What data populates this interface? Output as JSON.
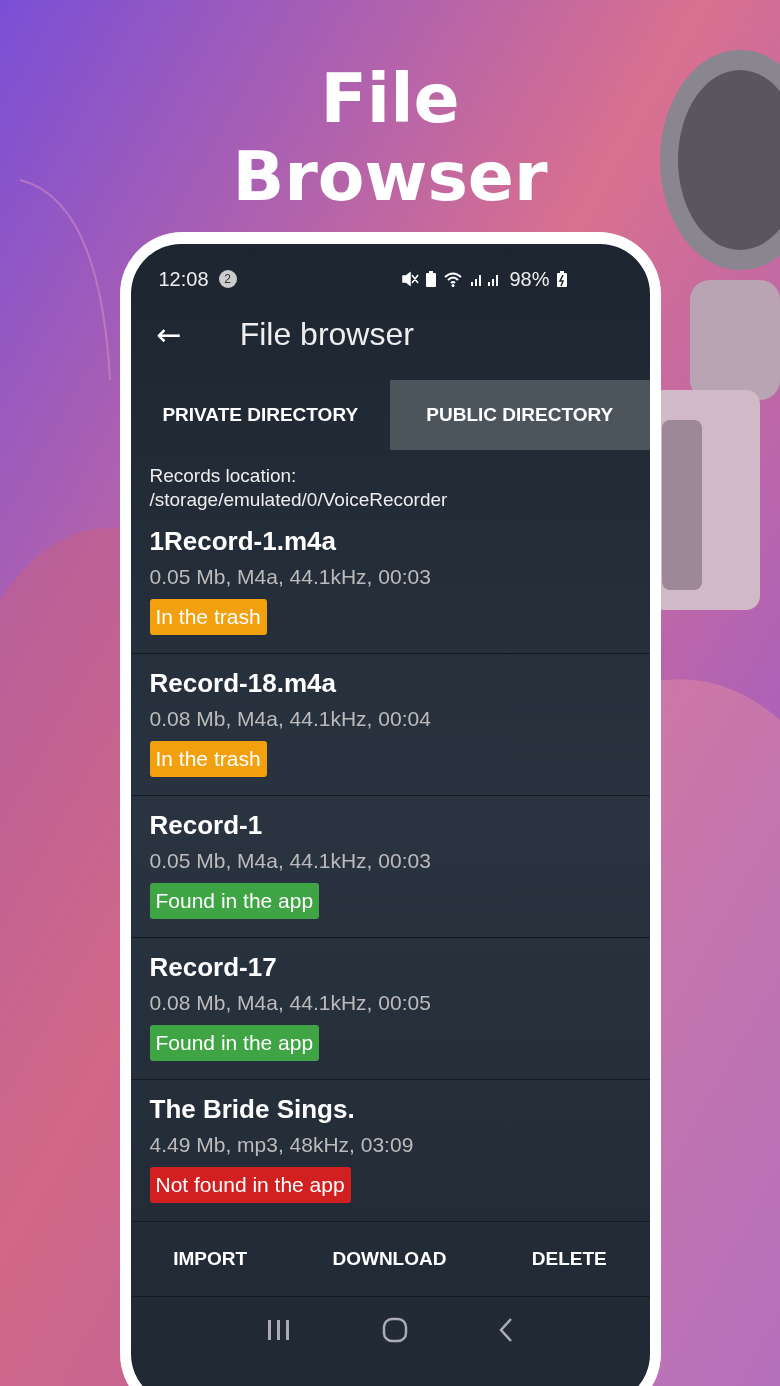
{
  "headline": [
    "File",
    "Browser"
  ],
  "status_bar": {
    "time": "12:08",
    "notification_count": "2",
    "battery": "98%"
  },
  "app_bar": {
    "back_icon": "←",
    "title": "File browser"
  },
  "tabs": [
    {
      "label": "PRIVATE DIRECTORY",
      "selected": false
    },
    {
      "label": "PUBLIC DIRECTORY",
      "selected": true
    }
  ],
  "location": {
    "label": "Records location:",
    "path": "/storage/emulated/0/VoiceRecorder"
  },
  "files": [
    {
      "name": "1Record-1.m4a",
      "details": "0.05 Mb, M4a, 44.1kHz, 00:03",
      "status": "In the trash",
      "color": "#f3a00e"
    },
    {
      "name": "Record-18.m4a",
      "details": "0.08 Mb, M4a, 44.1kHz, 00:04",
      "status": "In the trash",
      "color": "#f3a00e"
    },
    {
      "name": "Record-1",
      "details": "0.05 Mb, M4a, 44.1kHz, 00:03",
      "status": "Found in the app",
      "color": "#3ea444"
    },
    {
      "name": "Record-17",
      "details": "0.08 Mb, M4a, 44.1kHz, 00:05",
      "status": "Found in the app",
      "color": "#3ea444"
    },
    {
      "name": "The Bride Sings.",
      "details": "4.49 Mb, mp3, 48kHz, 03:09",
      "status": "Not found in the app",
      "color": "#d21f1f"
    }
  ],
  "actions": [
    "IMPORT",
    "DOWNLOAD",
    "DELETE"
  ]
}
